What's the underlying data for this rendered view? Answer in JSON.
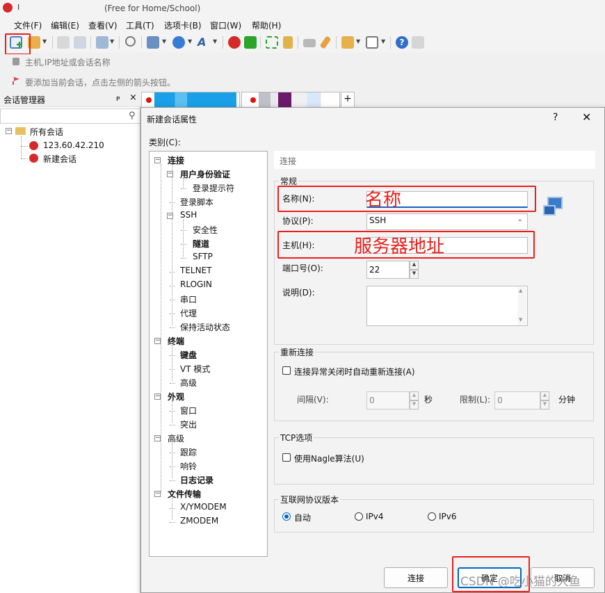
{
  "titlebar": {
    "title": "(Free for Home/School)",
    "glyph": "I"
  },
  "menu": [
    "文件(F)",
    "编辑(E)",
    "查看(V)",
    "工具(T)",
    "选项卡(B)",
    "窗口(W)",
    "帮助(H)"
  ],
  "address_bar": {
    "placeholder": "主机,IP地址或会话名称"
  },
  "hint_bar": {
    "text": "要添加当前会话，点击左侧的箭头按钮。"
  },
  "session_manager": {
    "title": "会话管理器",
    "pin": "ᴘ",
    "close": "×",
    "tree": {
      "root": "所有会话",
      "items": [
        "123.60.42.210",
        "新建会话"
      ]
    }
  },
  "tabs": {
    "add": "+"
  },
  "dialog": {
    "title": "新建会话属性",
    "help": "?",
    "close": "✕",
    "category_label": "类别(C):",
    "categories": [
      {
        "label": "连接",
        "bold": true,
        "level": 0,
        "expander": "−"
      },
      {
        "label": "用户身份验证",
        "bold": true,
        "level": 1,
        "expander": "−"
      },
      {
        "label": "登录提示符",
        "bold": false,
        "level": 2
      },
      {
        "label": "登录脚本",
        "bold": false,
        "level": 1
      },
      {
        "label": "SSH",
        "bold": false,
        "level": 1,
        "expander": "−"
      },
      {
        "label": "安全性",
        "bold": false,
        "level": 2
      },
      {
        "label": "隧道",
        "bold": true,
        "level": 2
      },
      {
        "label": "SFTP",
        "bold": false,
        "level": 2
      },
      {
        "label": "TELNET",
        "bold": false,
        "level": 1
      },
      {
        "label": "RLOGIN",
        "bold": false,
        "level": 1
      },
      {
        "label": "串口",
        "bold": false,
        "level": 1
      },
      {
        "label": "代理",
        "bold": false,
        "level": 1
      },
      {
        "label": "保持活动状态",
        "bold": false,
        "level": 1
      },
      {
        "label": "终端",
        "bold": true,
        "level": 0,
        "expander": "−"
      },
      {
        "label": "键盘",
        "bold": true,
        "level": 1
      },
      {
        "label": "VT 模式",
        "bold": false,
        "level": 1
      },
      {
        "label": "高级",
        "bold": false,
        "level": 1
      },
      {
        "label": "外观",
        "bold": true,
        "level": 0,
        "expander": "−"
      },
      {
        "label": "窗口",
        "bold": false,
        "level": 1
      },
      {
        "label": "突出",
        "bold": false,
        "level": 1
      },
      {
        "label": "高级",
        "bold": false,
        "level": 0,
        "expander": "−"
      },
      {
        "label": "跟踪",
        "bold": false,
        "level": 1
      },
      {
        "label": "响铃",
        "bold": false,
        "level": 1
      },
      {
        "label": "日志记录",
        "bold": true,
        "level": 1
      },
      {
        "label": "文件传输",
        "bold": true,
        "level": 0,
        "expander": "−"
      },
      {
        "label": "X/YMODEM",
        "bold": false,
        "level": 1
      },
      {
        "label": "ZMODEM",
        "bold": false,
        "level": 1
      }
    ],
    "panel_header": "连接",
    "general": {
      "title": "常规",
      "name_label": "名称(N):",
      "name_value": ".",
      "protocol_label": "协议(P):",
      "protocol_value": "SSH",
      "host_label": "主机(H):",
      "host_value": "",
      "port_label": "端口号(O):",
      "port_value": "22",
      "desc_label": "说明(D):",
      "desc_value": ""
    },
    "reconnect": {
      "title": "重新连接",
      "checkbox_label": "连接异常关闭时自动重新连接(A)",
      "interval_label": "间隔(V):",
      "interval_value": "0",
      "interval_unit": "秒",
      "limit_label": "限制(L):",
      "limit_value": "0",
      "limit_unit": "分钟"
    },
    "tcp": {
      "title": "TCP选项",
      "checkbox_label": "使用Nagle算法(U)"
    },
    "ip_version": {
      "title": "互联网协议版本",
      "options": [
        "自动",
        "IPv4",
        "IPv6"
      ],
      "selected": "自动"
    },
    "buttons": {
      "connect": "连接",
      "ok": "确定",
      "cancel": "取消"
    }
  },
  "annotations": {
    "name": "名称",
    "host": "服务器地址"
  },
  "watermark": "CSDN @吃小猫的大鱼",
  "colors": {
    "annotation_red": "#e8201c",
    "accent_blue": "#0067c0",
    "netsarang_red": "#d62a2a"
  }
}
